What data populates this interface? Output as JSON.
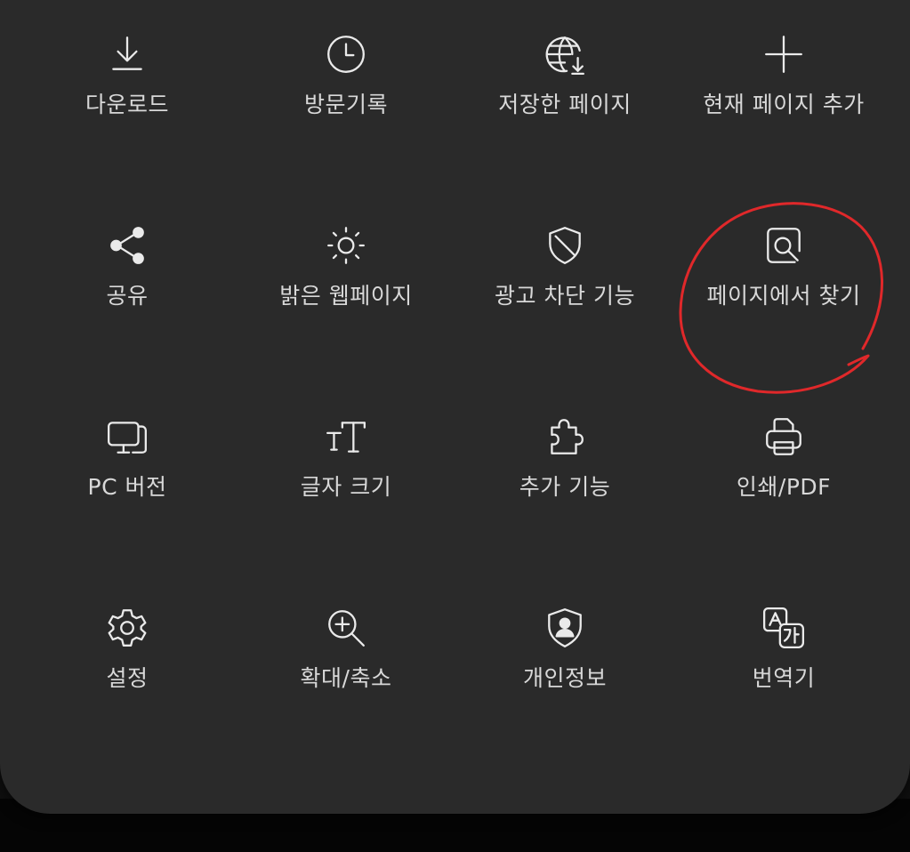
{
  "menu": {
    "items": [
      {
        "label": "다운로드",
        "icon": "download-icon"
      },
      {
        "label": "방문기록",
        "icon": "clock-icon"
      },
      {
        "label": "저장한 페이지",
        "icon": "globe-download-icon"
      },
      {
        "label": "현재 페이지 추가",
        "icon": "plus-icon"
      },
      {
        "label": "공유",
        "icon": "share-icon"
      },
      {
        "label": "밝은 웹페이지",
        "icon": "sun-icon"
      },
      {
        "label": "광고 차단 기능",
        "icon": "shield-block-icon"
      },
      {
        "label": "페이지에서 찾기",
        "icon": "find-in-page-icon"
      },
      {
        "label": "PC 버전",
        "icon": "desktop-icon"
      },
      {
        "label": "글자 크기",
        "icon": "text-size-icon"
      },
      {
        "label": "추가 기능",
        "icon": "puzzle-icon"
      },
      {
        "label": "인쇄/PDF",
        "icon": "printer-icon"
      },
      {
        "label": "설정",
        "icon": "gear-icon"
      },
      {
        "label": "확대/축소",
        "icon": "zoom-in-icon"
      },
      {
        "label": "개인정보",
        "icon": "privacy-shield-icon"
      },
      {
        "label": "번역기",
        "icon": "translate-icon"
      }
    ]
  },
  "colors": {
    "panel_background": "#2a2a2a",
    "icon_and_text": "#eaeaea",
    "annotation_circle": "#e0282a"
  }
}
